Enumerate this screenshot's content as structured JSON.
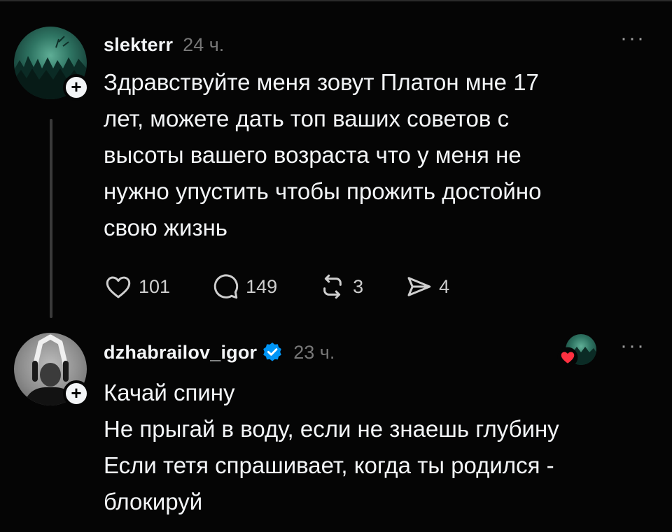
{
  "posts": [
    {
      "username": "slekterr",
      "time": "24 ч.",
      "text_lines": [
        "Здравствуйте меня зовут Платон мне 17",
        "лет, можете дать топ ваших советов с",
        "высоты вашего возраста что у меня не",
        "нужно упустить чтобы прожить достойно",
        "свою жизнь"
      ],
      "likes": "101",
      "comments": "149",
      "reposts": "3",
      "shares": "4",
      "follow_symbol": "+",
      "more_symbol": "···"
    },
    {
      "username": "dzhabrailov_igor",
      "verified": true,
      "time": "23 ч.",
      "text_lines": [
        "Качай спину",
        "Не прыгай в воду, если не знаешь глубину",
        "Если тетя спрашивает, когда ты родился -",
        "блокируй"
      ],
      "follow_symbol": "+",
      "more_symbol": "···"
    }
  ],
  "icons": {
    "like": "heart-outline-icon",
    "comment": "comment-bubble-icon",
    "repost": "repost-arrows-icon",
    "share": "paper-plane-icon",
    "verified": "verified-check-icon",
    "liked_by_author": "heart-filled-icon"
  },
  "colors": {
    "background": "#050505",
    "text": "#f3f5f7",
    "muted": "#777777",
    "verified": "#0095f6",
    "heart": "#ff3040"
  }
}
